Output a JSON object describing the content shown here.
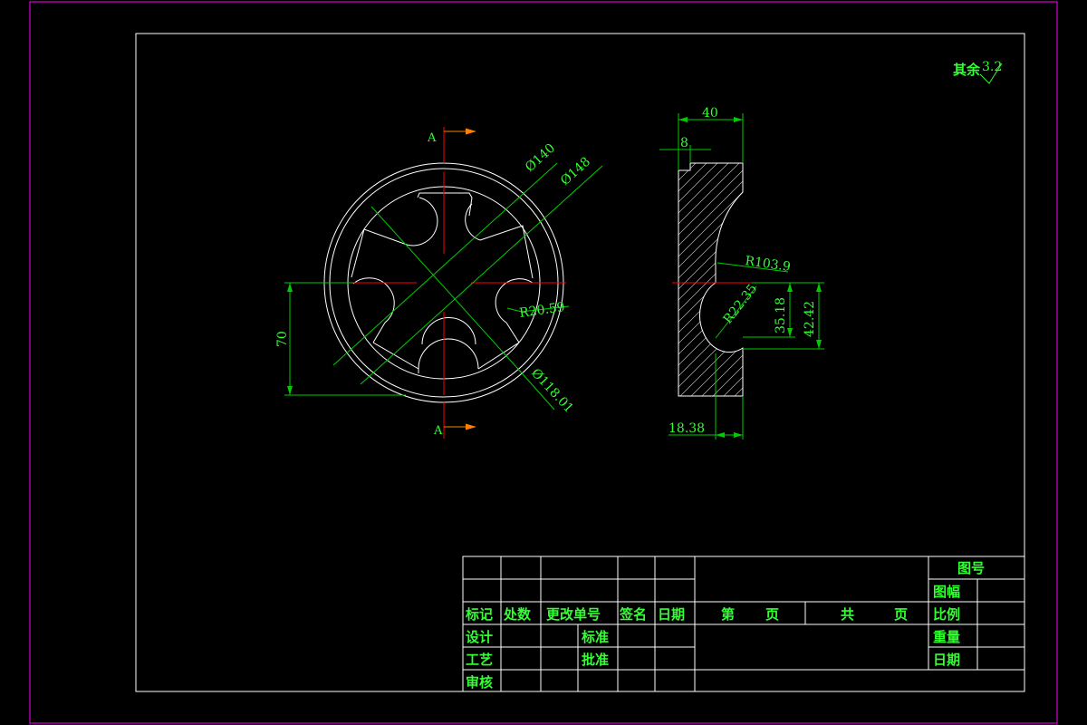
{
  "surface_note": {
    "prefix": "其余",
    "value": "3.2"
  },
  "section_letter": "A",
  "dims": {
    "d140": "Ø140",
    "d148": "Ø148",
    "d118": "Ø118.01",
    "r20": "R20.59",
    "h70": "70",
    "w40": "40",
    "w8": "8",
    "r103": "R103.9",
    "r22": "R22.35",
    "h35": "35.18",
    "h42": "42.42",
    "w18": "18.38"
  },
  "title_block": {
    "row_labels": [
      "标记",
      "处数",
      "更改单号",
      "签名",
      "日期"
    ],
    "design": "设计",
    "process": "工艺",
    "review": "审核",
    "standard": "标准",
    "approve": "批准",
    "page_no": "第",
    "page_total": "共",
    "page_unit": "页",
    "drawing_no": "图号",
    "sheet_size": "图幅",
    "scale": "比例",
    "weight": "重量",
    "date": "日期"
  },
  "colors": {
    "frame": "#ff00ff",
    "border": "#ffffff",
    "text": "#33ff33",
    "center_line": "#ff0000",
    "arrow": "#ff8000"
  }
}
